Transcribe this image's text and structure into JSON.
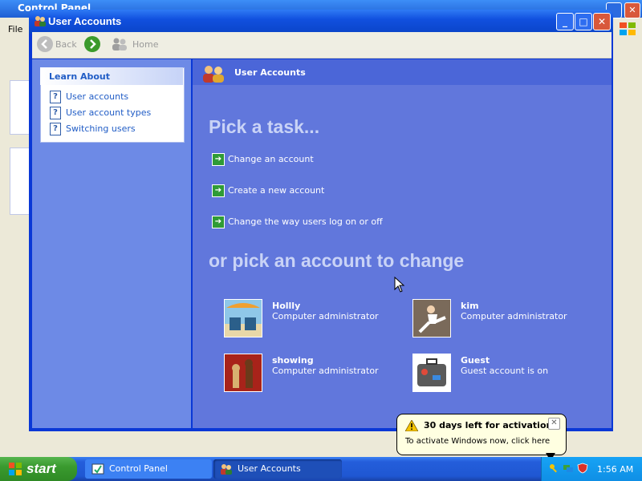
{
  "background_window": {
    "title": "Control Panel",
    "menu_file": "File"
  },
  "window": {
    "title": "User Accounts",
    "buttons": {
      "minimize": "_",
      "maximize": "□",
      "close": "✕"
    }
  },
  "navbar": {
    "back_label": "Back",
    "home_label": "Home"
  },
  "sidebar": {
    "learn_about": {
      "title": "Learn About",
      "items": [
        {
          "label": "User accounts"
        },
        {
          "label": "User account types"
        },
        {
          "label": "Switching users"
        }
      ]
    }
  },
  "content": {
    "header_title": "User Accounts",
    "pick_task_heading": "Pick a task...",
    "tasks": [
      {
        "label": "Change an account"
      },
      {
        "label": "Create a new account"
      },
      {
        "label": "Change the way users log on or off"
      }
    ],
    "pick_account_heading": "or pick an account to change",
    "accounts": [
      {
        "name": "Hollly",
        "role": "Computer administrator",
        "picture": "beach-chairs-icon"
      },
      {
        "name": "kim",
        "role": "Computer administrator",
        "picture": "karate-icon"
      },
      {
        "name": "showing",
        "role": "Computer administrator",
        "picture": "chess-icon"
      },
      {
        "name": "Guest",
        "role": "Guest account is on",
        "picture": "suitcase-icon"
      }
    ]
  },
  "balloon": {
    "title": "30 days left for activation",
    "text": "To activate Windows now, click here",
    "close": "✕"
  },
  "taskbar": {
    "start_label": "start",
    "tasks": [
      {
        "label": "Control Panel"
      },
      {
        "label": "User Accounts"
      }
    ],
    "clock": "1:56 AM"
  },
  "colors": {
    "content_bg": "#6177dc",
    "sidebar_bg": "#6d8ae6",
    "title_bar": "#0a44c8",
    "taskbar": "#245edb",
    "start_green": "#3a9a2f"
  }
}
